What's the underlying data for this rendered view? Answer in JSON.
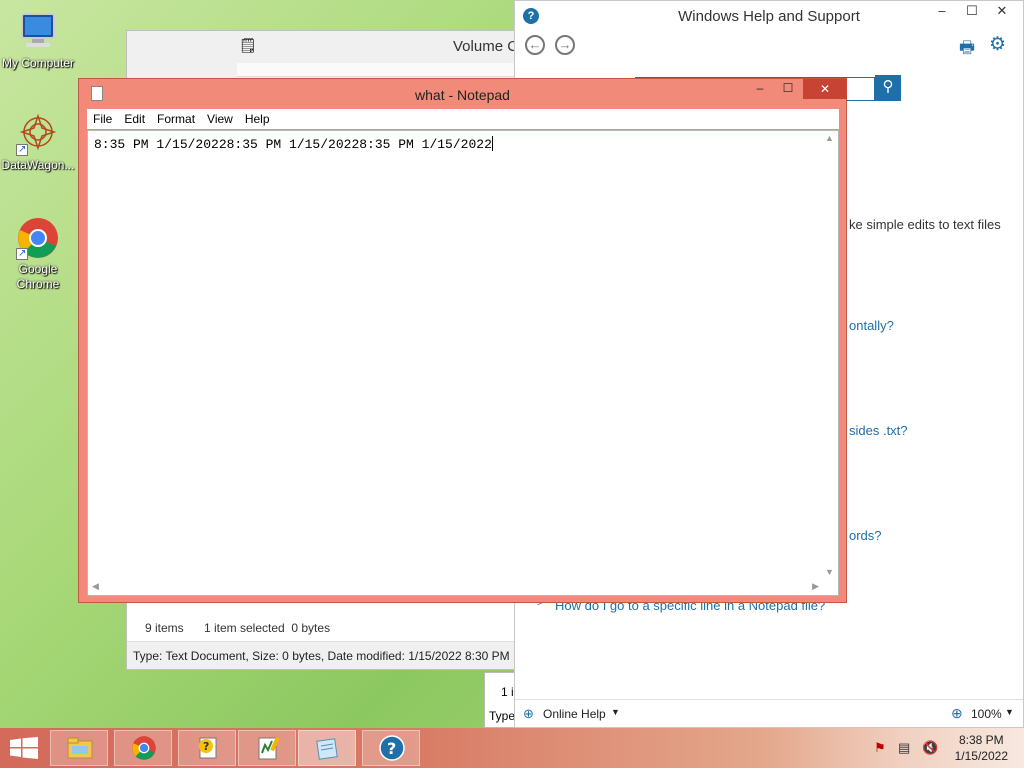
{
  "desktop": {
    "icons": [
      {
        "label": "My Computer",
        "icon": "computer-icon"
      },
      {
        "label": "DataWagon...",
        "icon": "datawagon-icon"
      },
      {
        "label": "Google Chrome",
        "icon": "chrome-icon"
      }
    ]
  },
  "help_window": {
    "title": "Windows Help and Support",
    "fragments": [
      "ke simple edits to text files",
      "ontally?",
      "sides .txt?",
      "ords?",
      "How do I go to a specific line in a Notepad file?"
    ],
    "online_help": "Online Help",
    "zoom": "100%"
  },
  "explorer_window": {
    "title": "Volume C",
    "status_items": "9 items",
    "status_selected": "1 item selected  0 bytes",
    "details": "Type: Text Document, Size: 0 bytes, Date modified: 1/15/2022 8:30 PM"
  },
  "partial_window": {
    "line1": "1 i",
    "line2": "Type"
  },
  "notepad": {
    "title": "what - Notepad",
    "menu": [
      "File",
      "Edit",
      "Format",
      "View",
      "Help"
    ],
    "content": "8:35 PM 1/15/20228:35 PM 1/15/20228:35 PM 1/15/2022"
  },
  "taskbar": {
    "buttons": [
      "file-explorer-icon",
      "chrome-icon",
      "help-doc-icon",
      "notepad-plus-icon",
      "notepad-icon",
      "help-icon"
    ],
    "time": "8:38 PM",
    "date": "1/15/2022"
  },
  "colors": {
    "notepad_frame": "#f28a7a",
    "help_accent": "#1f6fa8",
    "taskbar": "#d46a5a"
  }
}
